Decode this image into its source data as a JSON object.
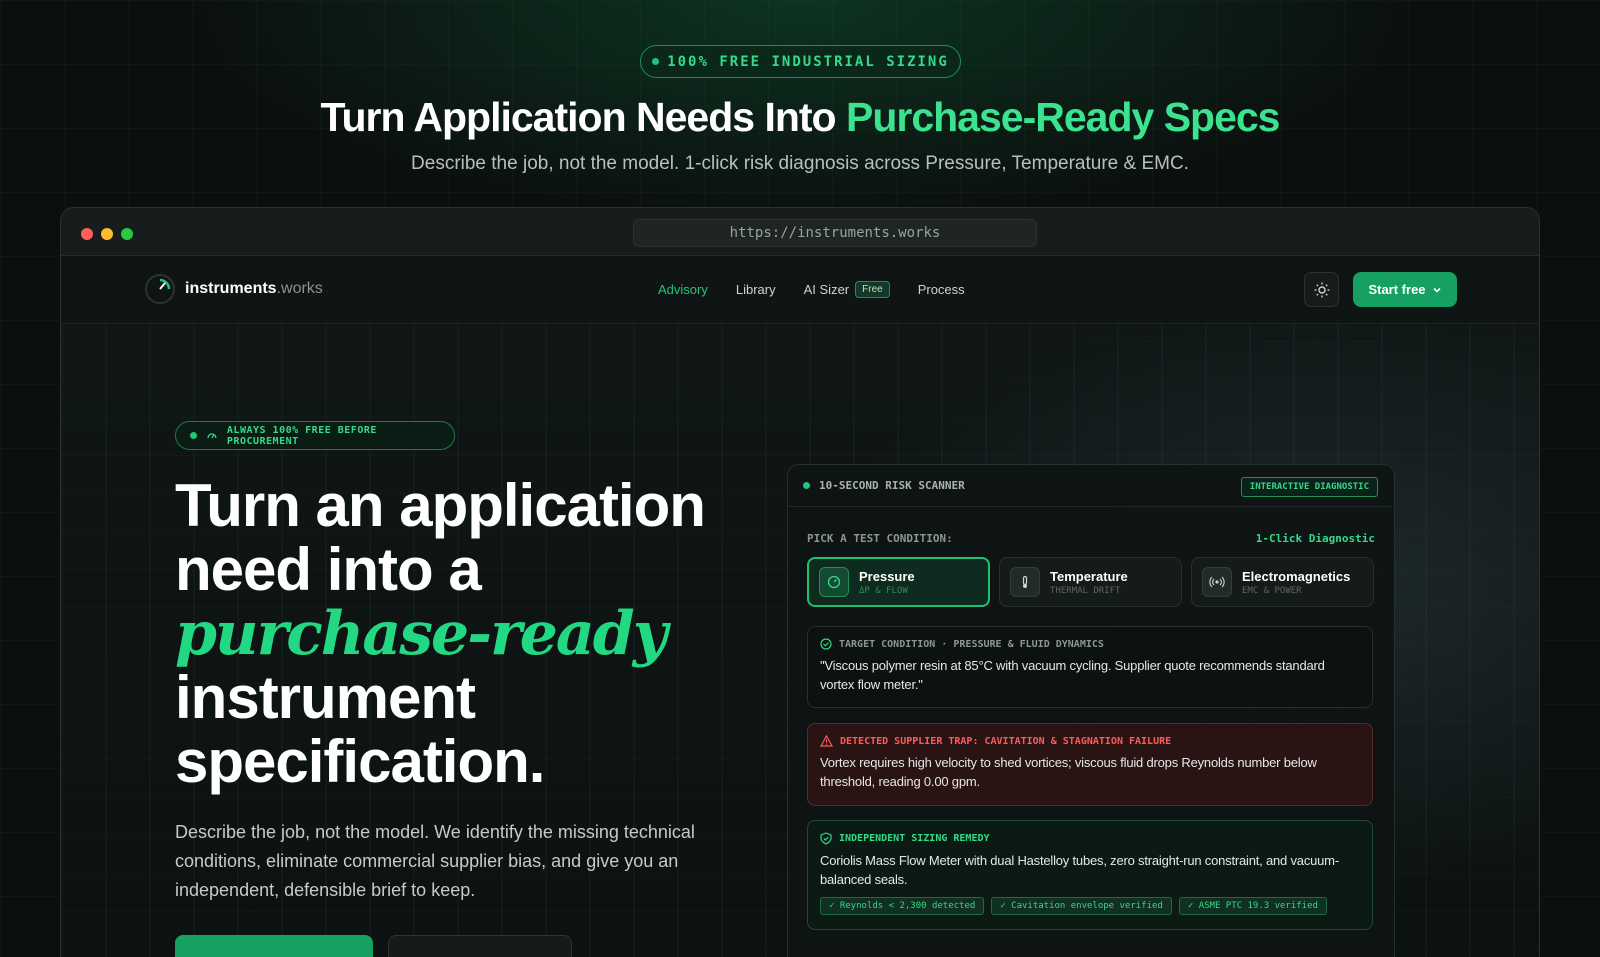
{
  "top": {
    "pill": "100% FREE INDUSTRIAL SIZING",
    "title_main": "Turn Application Needs Into ",
    "title_accent": "Purchase-Ready Specs",
    "subtitle": "Describe the job, not the model. 1-click risk diagnosis across Pressure, Temperature & EMC."
  },
  "browser": {
    "url": "https://instruments.works",
    "traffic_lights": [
      "#ff5f57",
      "#febc2e",
      "#28c840"
    ]
  },
  "nav": {
    "logo_main": "instruments",
    "logo_suffix": ".works",
    "links": [
      "Advisory",
      "Library",
      "AI Sizer",
      "Process"
    ],
    "ai_sizer_badge": "Free",
    "theme_icon": "sun-icon",
    "start_label": "Start free"
  },
  "hero": {
    "pill": "ALWAYS 100% FREE BEFORE PROCUREMENT",
    "title_line1": "Turn an application",
    "title_line2": "need into a",
    "title_script": "purchase-ready",
    "title_line4": "instrument",
    "title_line5": "specification.",
    "description": "Describe the job, not the model. We identify the missing technical conditions, eliminate commercial supplier bias, and give you an independent, defensible brief to keep."
  },
  "scanner": {
    "title": "10-SECOND RISK SCANNER",
    "badge": "INTERACTIVE DIAGNOSTIC",
    "pick_label": "PICK A TEST CONDITION:",
    "pick_right": "1-Click Diagnostic",
    "conditions": [
      {
        "name": "Pressure",
        "sub": "ΔP & FLOW",
        "icon": "gauge-icon",
        "active": true
      },
      {
        "name": "Temperature",
        "sub": "THERMAL DRIFT",
        "icon": "thermometer-icon",
        "active": false
      },
      {
        "name": "Electromagnetics",
        "sub": "EMC & POWER",
        "icon": "signal-icon",
        "active": false
      }
    ],
    "target": {
      "head": "TARGET CONDITION · PRESSURE & FLUID DYNAMICS",
      "body": "\"Viscous polymer resin at 85°C with vacuum cycling. Supplier quote recommends standard vortex flow meter.\""
    },
    "trap": {
      "head": "DETECTED SUPPLIER TRAP: CAVITATION & STAGNATION FAILURE",
      "body": "Vortex requires high velocity to shed vortices; viscous fluid drops Reynolds number below threshold, reading 0.00 gpm."
    },
    "remedy": {
      "head": "INDEPENDENT SIZING REMEDY",
      "body": "Coriolis Mass Flow Meter with dual Hastelloy tubes, zero straight-run constraint, and vacuum-balanced seals.",
      "chips": [
        "✓ Reynolds < 2,300 detected",
        "✓ Cavitation envelope verified",
        "✓ ASME PTC 19.3 verified"
      ]
    }
  }
}
